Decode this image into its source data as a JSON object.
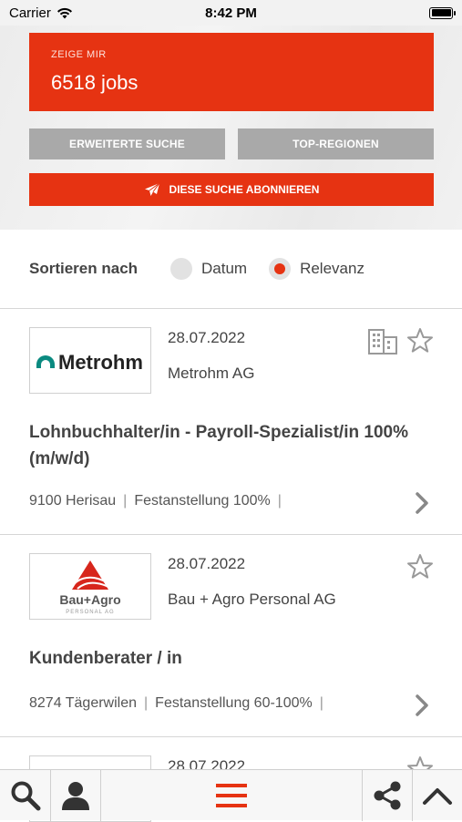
{
  "status": {
    "carrier": "Carrier",
    "time": "8:42 PM"
  },
  "search": {
    "label": "ZEIGE MIR",
    "count": "6518 jobs",
    "advanced_label": "ERWEITERTE SUCHE",
    "regions_label": "TOP-REGIONEN",
    "subscribe_label": "DIESE SUCHE ABONNIEREN"
  },
  "sort": {
    "label": "Sortieren nach",
    "options": [
      {
        "label": "Datum",
        "selected": false
      },
      {
        "label": "Relevanz",
        "selected": true
      }
    ]
  },
  "jobs": [
    {
      "date": "28.07.2022",
      "company": "Metrohm AG",
      "logo_text": "Metrohm",
      "title": "Lohnbuchhalter/in - Payroll-Spezialist/in 100% (m/w/d)",
      "location": "9100 Herisau",
      "employment": "Festanstellung 100%"
    },
    {
      "date": "28.07.2022",
      "company": "Bau + Agro Personal AG",
      "logo_text": "Bau+Agro",
      "logo_subtext": "PERSONAL AG",
      "title": "Kundenberater / in",
      "location": "8274 Tägerwilen",
      "employment": "Festanstellung 60-100%"
    },
    {
      "date": "28.07.2022"
    }
  ],
  "colors": {
    "accent": "#e63312",
    "grey_button": "#a9a9a9",
    "text": "#444444"
  },
  "tabbar": {
    "icons": [
      "search-icon",
      "user-icon",
      "menu-icon",
      "share-icon",
      "chevron-up-icon"
    ]
  }
}
